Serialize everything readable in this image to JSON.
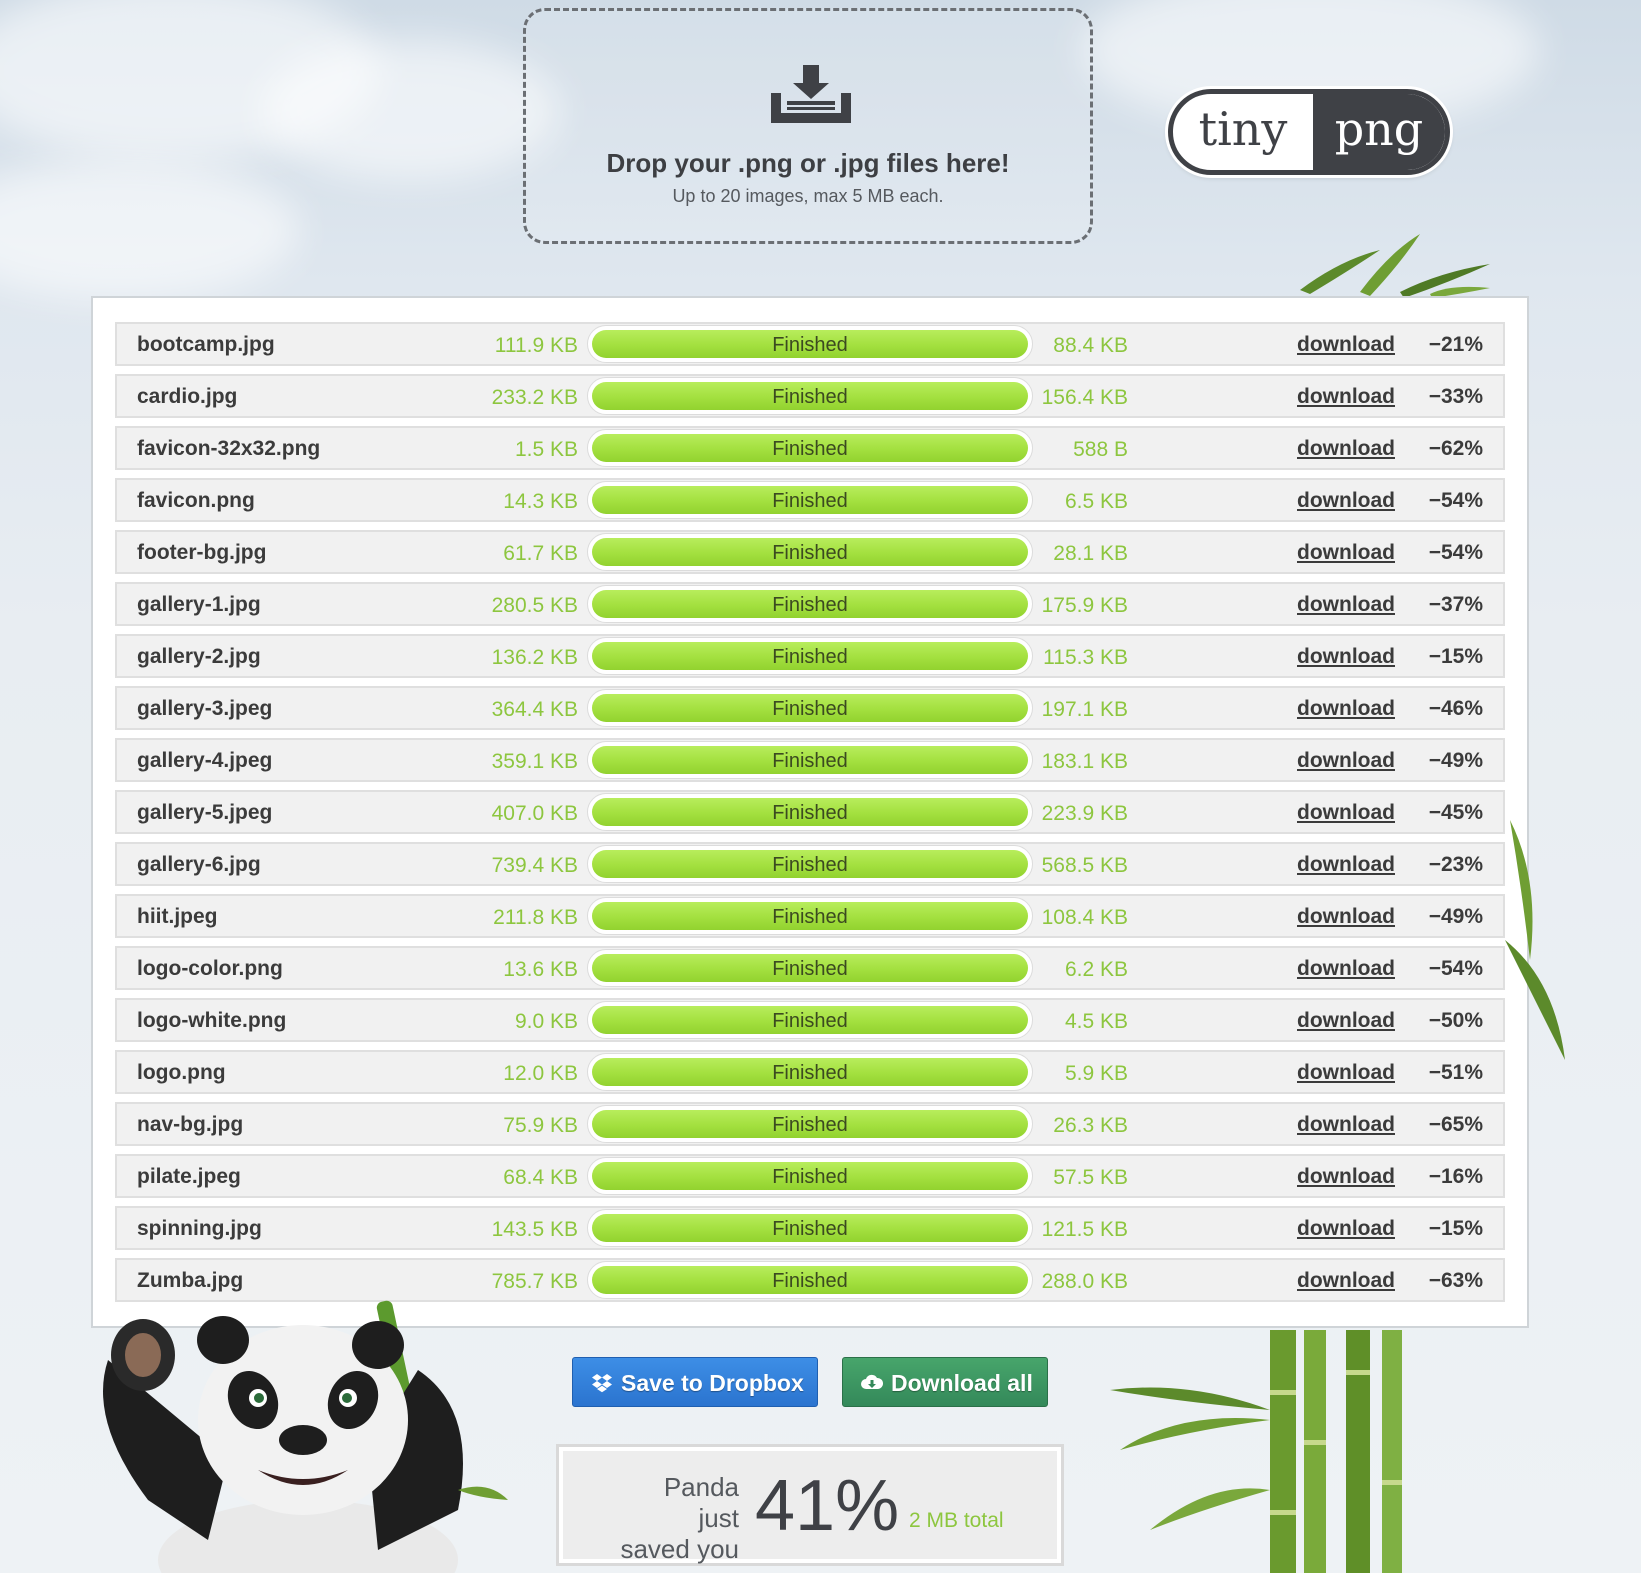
{
  "dropzone": {
    "title": "Drop your .png or .jpg files here!",
    "subtitle": "Up to 20 images, max 5 MB each.",
    "icon": "download-tray-icon"
  },
  "logo": {
    "left": "tiny",
    "right": "png"
  },
  "files": [
    {
      "name": "bootcamp.jpg",
      "original": "111.9 KB",
      "status": "Finished",
      "compressed": "88.4 KB",
      "action": "download",
      "saving": "−21%"
    },
    {
      "name": "cardio.jpg",
      "original": "233.2 KB",
      "status": "Finished",
      "compressed": "156.4 KB",
      "action": "download",
      "saving": "−33%"
    },
    {
      "name": "favicon-32x32.png",
      "original": "1.5 KB",
      "status": "Finished",
      "compressed": "588 B",
      "action": "download",
      "saving": "−62%"
    },
    {
      "name": "favicon.png",
      "original": "14.3 KB",
      "status": "Finished",
      "compressed": "6.5 KB",
      "action": "download",
      "saving": "−54%"
    },
    {
      "name": "footer-bg.jpg",
      "original": "61.7 KB",
      "status": "Finished",
      "compressed": "28.1 KB",
      "action": "download",
      "saving": "−54%"
    },
    {
      "name": "gallery-1.jpg",
      "original": "280.5 KB",
      "status": "Finished",
      "compressed": "175.9 KB",
      "action": "download",
      "saving": "−37%"
    },
    {
      "name": "gallery-2.jpg",
      "original": "136.2 KB",
      "status": "Finished",
      "compressed": "115.3 KB",
      "action": "download",
      "saving": "−15%"
    },
    {
      "name": "gallery-3.jpeg",
      "original": "364.4 KB",
      "status": "Finished",
      "compressed": "197.1 KB",
      "action": "download",
      "saving": "−46%"
    },
    {
      "name": "gallery-4.jpeg",
      "original": "359.1 KB",
      "status": "Finished",
      "compressed": "183.1 KB",
      "action": "download",
      "saving": "−49%"
    },
    {
      "name": "gallery-5.jpeg",
      "original": "407.0 KB",
      "status": "Finished",
      "compressed": "223.9 KB",
      "action": "download",
      "saving": "−45%"
    },
    {
      "name": "gallery-6.jpg",
      "original": "739.4 KB",
      "status": "Finished",
      "compressed": "568.5 KB",
      "action": "download",
      "saving": "−23%"
    },
    {
      "name": "hiit.jpeg",
      "original": "211.8 KB",
      "status": "Finished",
      "compressed": "108.4 KB",
      "action": "download",
      "saving": "−49%"
    },
    {
      "name": "logo-color.png",
      "original": "13.6 KB",
      "status": "Finished",
      "compressed": "6.2 KB",
      "action": "download",
      "saving": "−54%"
    },
    {
      "name": "logo-white.png",
      "original": "9.0 KB",
      "status": "Finished",
      "compressed": "4.5 KB",
      "action": "download",
      "saving": "−50%"
    },
    {
      "name": "logo.png",
      "original": "12.0 KB",
      "status": "Finished",
      "compressed": "5.9 KB",
      "action": "download",
      "saving": "−51%"
    },
    {
      "name": "nav-bg.jpg",
      "original": "75.9 KB",
      "status": "Finished",
      "compressed": "26.3 KB",
      "action": "download",
      "saving": "−65%"
    },
    {
      "name": "pilate.jpeg",
      "original": "68.4 KB",
      "status": "Finished",
      "compressed": "57.5 KB",
      "action": "download",
      "saving": "−16%"
    },
    {
      "name": "spinning.jpg",
      "original": "143.5 KB",
      "status": "Finished",
      "compressed": "121.5 KB",
      "action": "download",
      "saving": "−15%"
    },
    {
      "name": "Zumba.jpg",
      "original": "785.7 KB",
      "status": "Finished",
      "compressed": "288.0 KB",
      "action": "download",
      "saving": "−63%"
    }
  ],
  "progress": 1.0,
  "buttons": {
    "dropbox": {
      "label": "Save to Dropbox",
      "icon": "dropbox-icon"
    },
    "download_all": {
      "label": "Download all",
      "icon": "cloud-download-icon"
    }
  },
  "savings": {
    "line1": "Panda just",
    "line2": "saved you",
    "percent": "41%",
    "total": "2 MB total"
  },
  "colors": {
    "accent_green": "#8dc63f",
    "bar_green": "#a3e03f",
    "dropbox_blue": "#2b74cf",
    "download_green": "#34895a",
    "dark": "#3f4146"
  }
}
